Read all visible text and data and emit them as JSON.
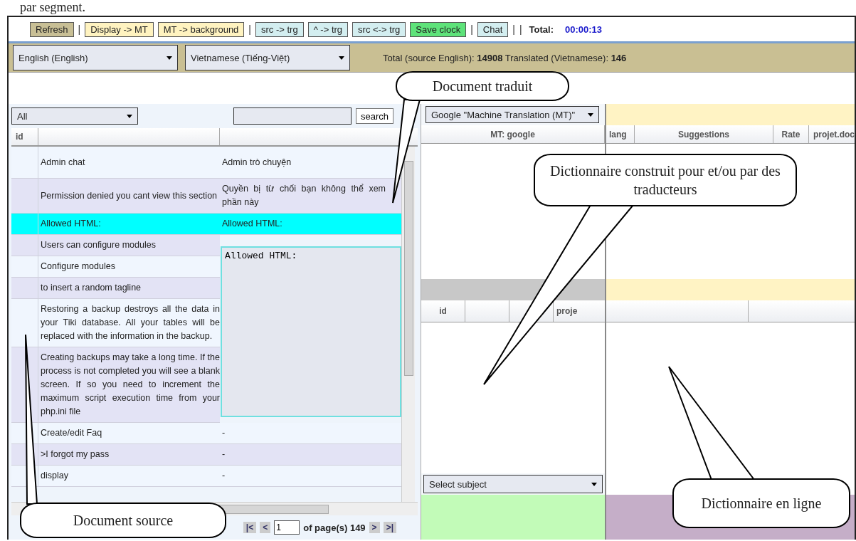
{
  "page_text": "par segment.",
  "toolbar": {
    "items": [
      {
        "kind": "button",
        "label": "Refresh"
      },
      {
        "kind": "separator",
        "label": "|"
      },
      {
        "kind": "button",
        "label": "Display -> MT"
      },
      {
        "kind": "button",
        "label": "MT -> background"
      },
      {
        "kind": "separator",
        "label": "|"
      },
      {
        "kind": "button",
        "label": "src -> trg"
      },
      {
        "kind": "button",
        "label": "^ -> trg"
      },
      {
        "kind": "button",
        "label": "src <-> trg"
      },
      {
        "kind": "button",
        "label": "Save clock"
      },
      {
        "kind": "separator",
        "label": "|"
      },
      {
        "kind": "button",
        "label": "Chat"
      },
      {
        "kind": "separator",
        "label": "|"
      },
      {
        "kind": "separator",
        "label": "|"
      }
    ],
    "total_label": "Total:",
    "total_time": "00:00:13"
  },
  "languages": {
    "source": "English (English)",
    "target": "Vietnamese (Tiếng-Việt)",
    "stats": "Total (source English): **14908** Translated (Vietnamese): **146**"
  },
  "segments": {
    "filter": "All",
    "search_button": "search",
    "columns": [
      "id"
    ],
    "rows": [
      {
        "source": "Admin chat",
        "target": "Admin trò chuyện",
        "selected": false
      },
      {
        "source": "Permission denied you cant view this section",
        "target": "Quyền bị từ chối bạn không thể xem phần này",
        "selected": false
      },
      {
        "source": "Allowed HTML:",
        "target": "Allowed HTML:",
        "selected": true
      },
      {
        "source": "Users can configure modules",
        "selected": false
      },
      {
        "source": "Configure modules",
        "selected": false
      },
      {
        "source": "to insert a random tagline",
        "selected": false
      },
      {
        "source": "Restoring a backup destroys all the data in your Tiki database. All your tables will be replaced with the information in the backup.",
        "selected": false
      },
      {
        "source": "Creating backups may take a long time. If the process is not completed you will see a blank screen. If so you need to increment the maximum script execution time from your php.ini file",
        "selected": false
      },
      {
        "source": "Create/edit Faq",
        "target": "-",
        "selected": false
      },
      {
        "source": ">I forgot my pass",
        "target": "-",
        "selected": false
      },
      {
        "source": "display",
        "target": "-",
        "selected": false
      }
    ],
    "editor": "Allowed HTML:",
    "pagination": {
      "first": "|<",
      "prev": "<",
      "page": "1",
      "of_pages": "of page(s) 149",
      "next": ">",
      "last": ">|"
    }
  },
  "mt": {
    "engine": "Google \"Machine Translation (MT)\"",
    "column": "MT: google",
    "lower_columns": [
      "id",
      "proje"
    ],
    "subject": "Select subject"
  },
  "suggestions": {
    "columns": [
      "lang",
      "Suggestions",
      "Rate",
      "projet.doc"
    ]
  },
  "callouts": [
    "Document traduit",
    "Dictionnaire construit pour et/ou par des traducteurs",
    "Document source",
    "Dictionnaire en ligne"
  ]
}
